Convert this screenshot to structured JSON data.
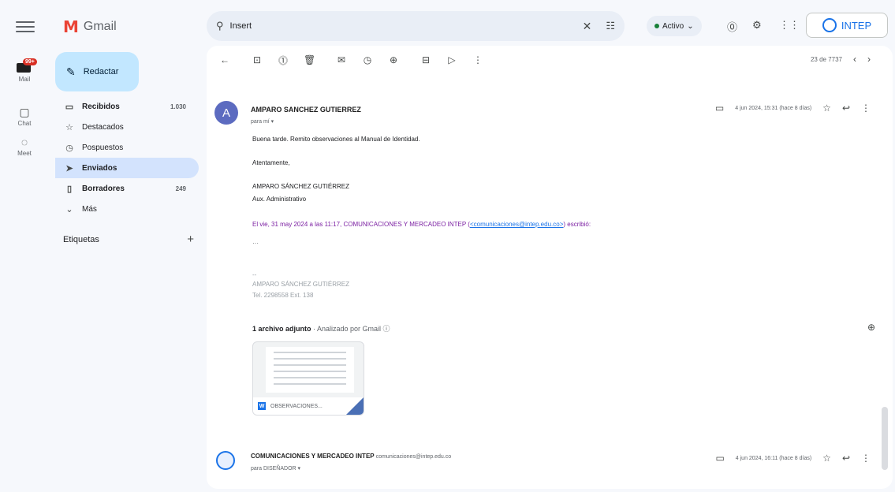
{
  "rail": {
    "mail_badge": "99+",
    "mail_label": "Mail",
    "chat_label": "Chat",
    "meet_label": "Meet"
  },
  "app": {
    "name": "Gmail"
  },
  "compose": {
    "label": "Redactar"
  },
  "nav": {
    "items": [
      {
        "label": "Recibidos",
        "count": "1.030"
      },
      {
        "label": "Destacados",
        "count": ""
      },
      {
        "label": "Pospuestos",
        "count": ""
      },
      {
        "label": "Enviados",
        "count": ""
      },
      {
        "label": "Borradores",
        "count": "249"
      },
      {
        "label": "Más",
        "count": ""
      }
    ]
  },
  "labels": {
    "title": "Etiquetas"
  },
  "search": {
    "value": "Insert",
    "placeholder": "Buscar correo"
  },
  "status": {
    "label": "Activo"
  },
  "brand": {
    "text": "INTEP"
  },
  "pager": {
    "text": "23 de 7737"
  },
  "message1": {
    "avatar_initial": "A",
    "sender": "AMPARO SANCHEZ GUTIERREZ",
    "to": "para mí ▾",
    "date": "4 jun 2024, 15:31 (hace 8 días)",
    "lines": {
      "greeting": "Buena tarde. Remito observaciones al Manual de Identidad.",
      "closing": "Atentamente,",
      "name": "AMPARO SÁNCHEZ GUTIÉRREZ",
      "role": "Aux. Administrativo",
      "quote_prefix": "El vie, 31 may 2024 a las 11:17, COMUNICACIONES Y MERCADEO INTEP (",
      "quote_email": "<comunicaciones@intep.edu.co>",
      "quote_suffix": ") escribió:",
      "ellipsis": "···"
    },
    "signature": {
      "dash": "--",
      "name": "AMPARO SÁNCHEZ GUTIÉRREZ",
      "phone": "Tel. 2298558 Ext. 138"
    },
    "attachment": {
      "count_label": "1 archivo adjunto",
      "scan_label": " · Analizado por Gmail ⓘ",
      "file_name": "OBSERVACIONES..."
    }
  },
  "message2": {
    "sender": "COMUNICACIONES Y MERCADEO INTEP",
    "email": "comunicaciones@intep.edu.co",
    "to": "para DISEÑADOR ▾",
    "date": "4 jun 2024, 16:11 (hace 8 días)"
  }
}
